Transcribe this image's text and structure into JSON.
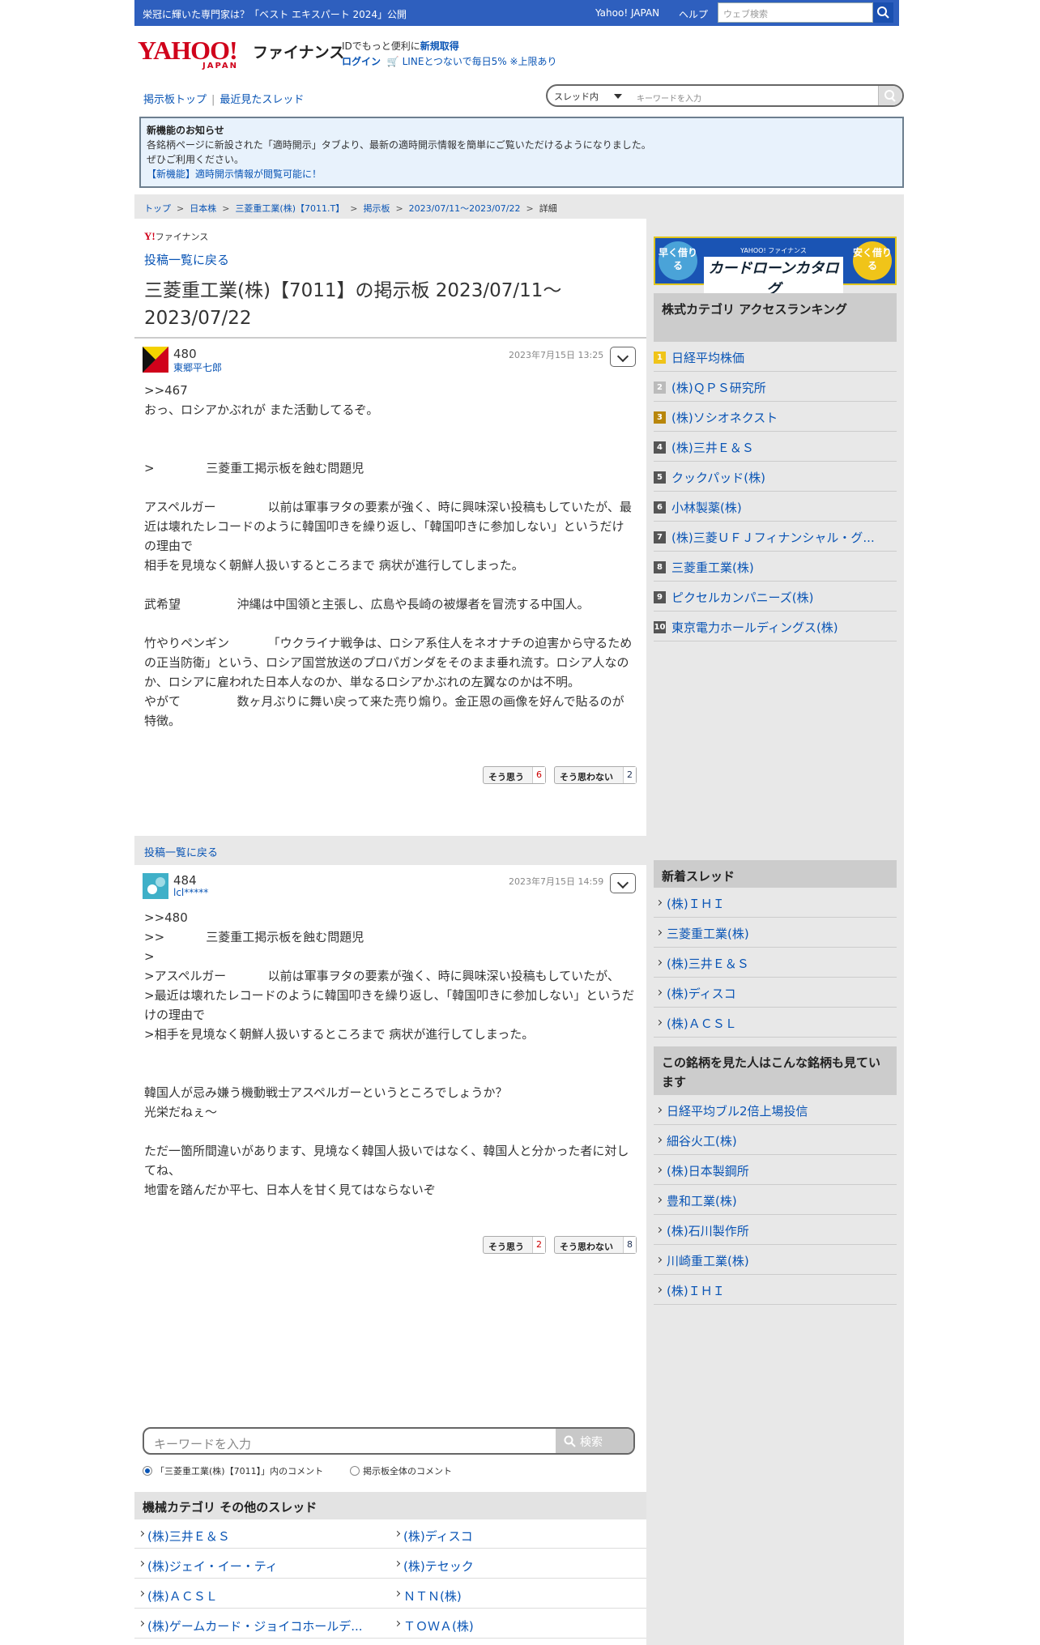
{
  "topbar": {
    "news": "栄冠に輝いた専門家は？「ベスト エキスパート 2024」公開",
    "yahoo_japan": "Yahoo! JAPAN",
    "help": "ヘルプ",
    "web_search_placeholder": "ウェブ検索"
  },
  "header": {
    "logo_text": "YAHOO!",
    "logo_sub": "JAPAN",
    "finance": "ファイナンス",
    "id_text": "IDでもっと便利に",
    "id_link": "新規取得",
    "login": "ログイン",
    "line_promo": "LINEとつないで毎日5% ※上限あり"
  },
  "subnav": {
    "board_top": "掲示板トップ",
    "recent": "最近見たスレッド",
    "scope": "スレッド内",
    "keyword_placeholder": "キーワードを入力"
  },
  "notice": {
    "title": "新機能のお知らせ",
    "line1": "各銘柄ページに新設された「適時開示」タブより、最新の適時開示情報を簡単にご覧いただけるようになりました。",
    "line2": "ぜひご利用ください。",
    "link": "【新機能】適時開示情報が閲覧可能に！"
  },
  "breadcrumb": [
    "トップ",
    "日本株",
    "三菱重工業(株)【7011.T】",
    "掲示板",
    "2023/07/11〜2023/07/22",
    "詳細"
  ],
  "main": {
    "ylogo": "ファイナンス",
    "back": "投稿一覧に戻る",
    "title": "三菱重工業(株)【7011】の掲示板 2023/07/11〜2023/07/22"
  },
  "posts": [
    {
      "num": "480",
      "author": "東郷平七郎",
      "date": "2023年7月15日 13:25",
      "reply": ">>467",
      "body": "おっ、ロシアかぶれが また活動してるぞ。\n\n\n>\t\t三菱重工掲示板を蝕む問題児\n\nアスペルガー\t\t以前は軍事ヲタの要素が強く、時に興味深い投稿もしていたが、最近は壊れたレコードのように韓国叩きを繰り返し、「韓国叩きに参加しない」というだけの理由で\n相手を見境なく朝鮮人扱いするところまで 病状が進行してしまった。\n\n武希望\t\t沖縄は中国領と主張し、広島や長崎の被爆者を冒涜する中国人。\n\n竹やりペンギン\t\t「ウクライナ戦争は、ロシア系住人をネオナチの迫害から守るための正当防衛」という、ロシア国営放送のプロパガンダをそのまま垂れ流す。ロシア人なのか、ロシアに雇われた日本人なのか、単なるロシアかぶれの左翼なのかは不明。\nやがて\t\t数ヶ月ぶりに舞い戻って来た売り煽り。金正恩の画像を好んで貼るのが特徴。",
      "agree_label": "そう思う",
      "agree": "6",
      "disagree_label": "そう思わない",
      "disagree": "2"
    },
    {
      "num": "484",
      "author": "lcl*****",
      "date": "2023年7月15日 14:59",
      "body": ">>480\n>>\t\t三菱重工掲示板を蝕む問題児\n>\n>アスペルガー\t\t以前は軍事ヲタの要素が強く、時に興味深い投稿もしていたが、\n>最近は壊れたレコードのように韓国叩きを繰り返し、「韓国叩きに参加しない」というだけの理由で\n>相手を見境なく朝鮮人扱いするところまで 病状が進行してしまった。\n\n\n韓国人が忌み嫌う機動戦士アスペルガーというところでしょうか？\n光栄だねぇ〜\n\nただ一箇所間違いがあります、見境なく韓国人扱いではなく、韓国人と分かった者に対してね、\n地雷を踏んだか平七、日本人を甘く見てはならないぞ",
      "agree_label": "そう思う",
      "agree": "2",
      "disagree_label": "そう思わない",
      "disagree": "8"
    }
  ],
  "search": {
    "placeholder": "キーワードを入力",
    "button": "検索",
    "radio_thread": "「三菱重工業(株)【7011】」内のコメント",
    "radio_all": "掲示板全体のコメント"
  },
  "other_threads": {
    "title": "機械カテゴリ その他のスレッド",
    "items": [
      "(株)三井Ｅ＆Ｓ",
      "(株)ディスコ",
      "(株)ジェイ・イー・ティ",
      "(株)テセック",
      "(株)ＡＣＳＬ",
      "ＮＴＮ(株)",
      "(株)ゲームカード・ジョイコホールデ...",
      "ＴＯＷＡ(株)"
    ]
  },
  "ad": {
    "left": "早く借りる",
    "right": "安く借りる",
    "brand": "YAHOO! ファイナンス",
    "title": "カードローンカタログ"
  },
  "ranking": {
    "title": "株式カテゴリ アクセスランキング",
    "items": [
      "日経平均株価",
      "(株)ＱＰＳ研究所",
      "(株)ソシオネクスト",
      "(株)三井Ｅ＆Ｓ",
      "クックパッド(株)",
      "小林製薬(株)",
      "(株)三菱ＵＦＪフィナンシャル・グ...",
      "三菱重工業(株)",
      "ピクセルカンパニーズ(株)",
      "東京電力ホールディングス(株)"
    ]
  },
  "new_threads": {
    "title": "新着スレッド",
    "items": [
      "(株)ＩＨＩ",
      "三菱重工業(株)",
      "(株)三井Ｅ＆Ｓ",
      "(株)ディスコ",
      "(株)ＡＣＳＬ"
    ]
  },
  "also_viewed": {
    "title": "この銘柄を見た人はこんな銘柄も見ています",
    "items": [
      "日経平均ブル2倍上場投信",
      "細谷火工(株)",
      "(株)日本製鋼所",
      "豊和工業(株)",
      "(株)石川製作所",
      "川崎重工業(株)",
      "(株)ＩＨＩ"
    ]
  },
  "colors": {
    "topbar": "#2e5fbe",
    "link": "#0a55b5",
    "notice_bg": "#e8f2fc",
    "rank1": "#f0c419",
    "rank2": "#bbbbbb",
    "rank3": "#b8860b",
    "rank_other": "#555555"
  }
}
